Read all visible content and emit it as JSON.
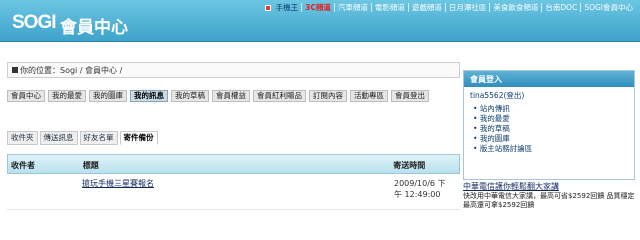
{
  "header": {
    "logo": "SOGI",
    "title": "會員中心",
    "nav": [
      {
        "label": "手機王",
        "style": "plain"
      },
      {
        "label": "3C頻道",
        "style": "hot"
      },
      {
        "label": "汽車頻道",
        "style": "normal"
      },
      {
        "label": "電影頻道",
        "style": "normal"
      },
      {
        "label": "遊戲頻道",
        "style": "normal"
      },
      {
        "label": "日月潭社區",
        "style": "normal"
      },
      {
        "label": "美食飲食頻道",
        "style": "normal"
      },
      {
        "label": "台南DOC",
        "style": "normal"
      },
      {
        "label": "SOGI會員中心",
        "style": "normal"
      }
    ]
  },
  "breadcrumb": "你的位置：Sogi / 會員中心 /",
  "tabs": [
    {
      "label": "會員中心",
      "active": false
    },
    {
      "label": "我的最愛",
      "active": false
    },
    {
      "label": "我的圖庫",
      "active": false
    },
    {
      "label": "我的訊息",
      "active": true
    },
    {
      "label": "我的草稿",
      "active": false
    },
    {
      "label": "會員權益",
      "active": false
    },
    {
      "label": "會員紅利贈品",
      "active": false
    },
    {
      "label": "訂閱內容",
      "active": false
    },
    {
      "label": "活動專區",
      "active": false
    },
    {
      "label": "會員登出",
      "active": false
    }
  ],
  "subtabs": [
    {
      "label": "收件夾",
      "active": false
    },
    {
      "label": "傳送訊息",
      "active": false
    },
    {
      "label": "好友名單",
      "active": false
    },
    {
      "label": "寄件備份",
      "active": true
    }
  ],
  "table": {
    "headers": {
      "sender": "收件者",
      "subject": "標題",
      "time": "寄送時間"
    },
    "rows": [
      {
        "sender": "",
        "subject": "搶玩手機三星賽報名",
        "time_date": "2009/10/6 下",
        "time_clock": "午 12:49:00"
      }
    ]
  },
  "sidebar": {
    "title": "會員登入",
    "user": "tina5562(登出)",
    "links": [
      "站內傳訊",
      "我的最愛",
      "我的草稿",
      "我的圖庫",
      "版主站務討論區"
    ]
  },
  "ad": {
    "title": "中華電信護你輕鬆翻大家講",
    "text": "快改用中華電信大家講，最高可省$2592回饋 品質穩定 最高還可拿$2592回饋"
  }
}
